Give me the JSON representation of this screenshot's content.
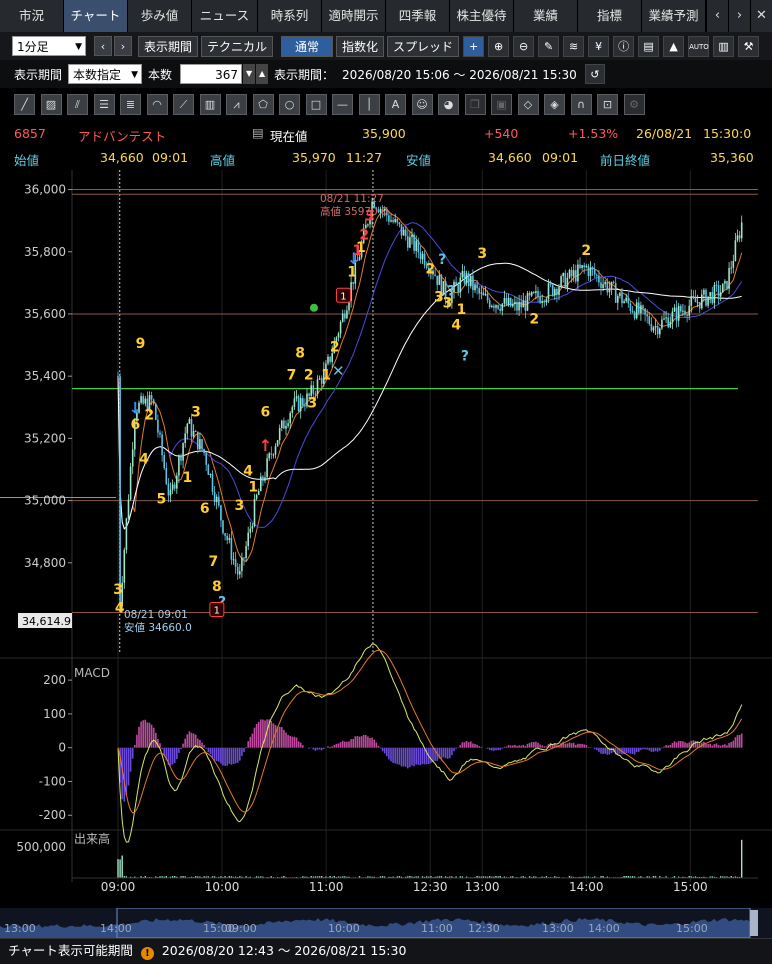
{
  "tabs": [
    "市況",
    "チャート",
    "歩み値",
    "ニュース",
    "時系列",
    "適時開示",
    "四季報",
    "株主優待",
    "業績",
    "指標",
    "業績予測"
  ],
  "tab_active_index": 1,
  "toolbar": {
    "interval": "1分足",
    "period_button": "表示期間",
    "technical_button": "テクニカル",
    "normal_button": "通常",
    "index_button": "指数化",
    "spread_button": "スプレッド",
    "auto_label": "AUTO"
  },
  "range_row": {
    "period_label": "表示期間",
    "period_mode": "本数指定",
    "count_label": "本数",
    "count_value": "367",
    "range_label": "表示期間：",
    "range_value": "2026/08/20 15:06 ～ 2026/08/21 15:30"
  },
  "quote": {
    "code": "6857",
    "name": "アドバンテスト",
    "current_label": "現在値",
    "current": "35,900",
    "change": "+540",
    "change_pct": "+1.53%",
    "date": "26/08/21",
    "time": "15:30:0",
    "open_label": "始値",
    "open": "34,660",
    "open_time": "09:01",
    "high_label": "高値",
    "high": "35,970",
    "high_time": "11:27",
    "low_label": "安値",
    "low": "34,660",
    "low_time": "09:01",
    "prev_label": "前日終値",
    "prev": "35,360"
  },
  "annotations": {
    "high_date": "08/21 11:27",
    "high_text": "高値 35970.0",
    "low_date": "08/21 09:01",
    "low_text": "安値 34660.0",
    "cursor_price": "34,614.9"
  },
  "panels": {
    "macd_label": "MACD",
    "volume_label": "出来高"
  },
  "colors": {
    "up": "#ff4040",
    "down": "#5fc3e6",
    "candle": "#9fe6c9",
    "ma_short": "#e07a2a",
    "ma_mid": "#4a4ad8",
    "ma_long": "#ffffff",
    "signal": "#ffcc33"
  },
  "chart_data": {
    "type": "line",
    "title": "",
    "xlabel": "",
    "ylabel": "",
    "x_ticks": [
      "09:00",
      "10:00",
      "11:00",
      "12:30",
      "13:00",
      "14:00",
      "15:00"
    ],
    "y_ticks": [
      "36,000",
      "35,800",
      "35,600",
      "35,400",
      "35,200",
      "35,000",
      "34,800"
    ],
    "ylim": [
      34600,
      36050
    ],
    "series": [
      {
        "x": [
          "09:00",
          "09:01",
          "09:10",
          "09:20",
          "09:30",
          "09:40",
          "09:50",
          "10:00",
          "10:10",
          "10:20",
          "10:30",
          "10:40",
          "10:50",
          "11:00",
          "11:10",
          "11:20",
          "11:27",
          "12:30",
          "12:40",
          "12:50",
          "13:00",
          "13:20",
          "13:40",
          "14:00",
          "14:20",
          "14:40",
          "15:00",
          "15:20",
          "15:30"
        ],
        "values": [
          35400,
          34660,
          35300,
          35320,
          35000,
          35250,
          35150,
          34930,
          34750,
          35010,
          35180,
          35300,
          35330,
          35420,
          35600,
          35810,
          35970,
          35760,
          35650,
          35720,
          35650,
          35620,
          35680,
          35750,
          35650,
          35560,
          35630,
          35680,
          35900
        ]
      }
    ],
    "macd": {
      "y_ticks": [
        "200",
        "100",
        "0",
        "-100",
        "-200"
      ],
      "ylim": [
        -220,
        230
      ]
    },
    "volume": {
      "y_ticks": [
        "500,000"
      ],
      "ylim": [
        0,
        650000
      ]
    },
    "navigator_ticks": [
      "13:00",
      "14:00",
      "15:00",
      "09:00",
      "10:00",
      "11:00",
      "12:30",
      "13:00",
      "14:00",
      "15:00"
    ]
  },
  "status": {
    "label": "チャート表示可能期間",
    "range": "2026/08/20 12:43 ～ 2026/08/21 15:30"
  }
}
